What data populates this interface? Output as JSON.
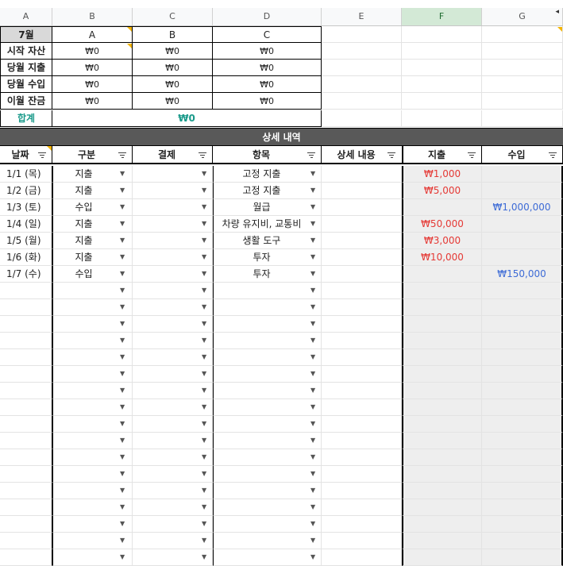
{
  "columns": [
    "A",
    "B",
    "C",
    "D",
    "E",
    "F",
    "G"
  ],
  "summary": {
    "month": "7월",
    "headers": [
      "A",
      "B",
      "C"
    ],
    "rows": [
      {
        "label": "시작 자산",
        "values": [
          "₩0",
          "₩0",
          "₩0"
        ]
      },
      {
        "label": "당월 지출",
        "values": [
          "₩0",
          "₩0",
          "₩0"
        ]
      },
      {
        "label": "당월 수입",
        "values": [
          "₩0",
          "₩0",
          "₩0"
        ]
      },
      {
        "label": "이월 잔금",
        "values": [
          "₩0",
          "₩0",
          "₩0"
        ]
      }
    ],
    "total_label": "합계",
    "total_value": "₩0"
  },
  "detail": {
    "title": "상세 내역",
    "headers": [
      "날짜",
      "구분",
      "결제",
      "항목",
      "상세 내용",
      "지출",
      "수입"
    ],
    "rows": [
      {
        "date": "1/1 (목)",
        "type": "지출",
        "payment": "",
        "item": "고정 지출",
        "memo": "",
        "expense": "₩1,000",
        "income": ""
      },
      {
        "date": "1/2 (금)",
        "type": "지출",
        "payment": "",
        "item": "고정 지출",
        "memo": "",
        "expense": "₩5,000",
        "income": ""
      },
      {
        "date": "1/3 (토)",
        "type": "수입",
        "payment": "",
        "item": "월급",
        "memo": "",
        "expense": "",
        "income": "₩1,000,000"
      },
      {
        "date": "1/4 (일)",
        "type": "지출",
        "payment": "",
        "item": "차량 유지비, 교통비",
        "memo": "",
        "expense": "₩50,000",
        "income": ""
      },
      {
        "date": "1/5 (월)",
        "type": "지출",
        "payment": "",
        "item": "생활 도구",
        "memo": "",
        "expense": "₩3,000",
        "income": ""
      },
      {
        "date": "1/6 (화)",
        "type": "지출",
        "payment": "",
        "item": "투자",
        "memo": "",
        "expense": "₩10,000",
        "income": ""
      },
      {
        "date": "1/7 (수)",
        "type": "수입",
        "payment": "",
        "item": "투자",
        "memo": "",
        "expense": "",
        "income": "₩150,000"
      }
    ],
    "empty_rows": 17
  },
  "colors": {
    "expense": "#e53935",
    "income": "#3d6bd6",
    "total": "#1a9a8a",
    "section_bg": "#595959",
    "selected_col": "#d3e9d6"
  },
  "icons": {
    "dropdown": "dropdown-arrow-icon",
    "filter": "filter-icon",
    "note": "comment-triangle-icon"
  }
}
